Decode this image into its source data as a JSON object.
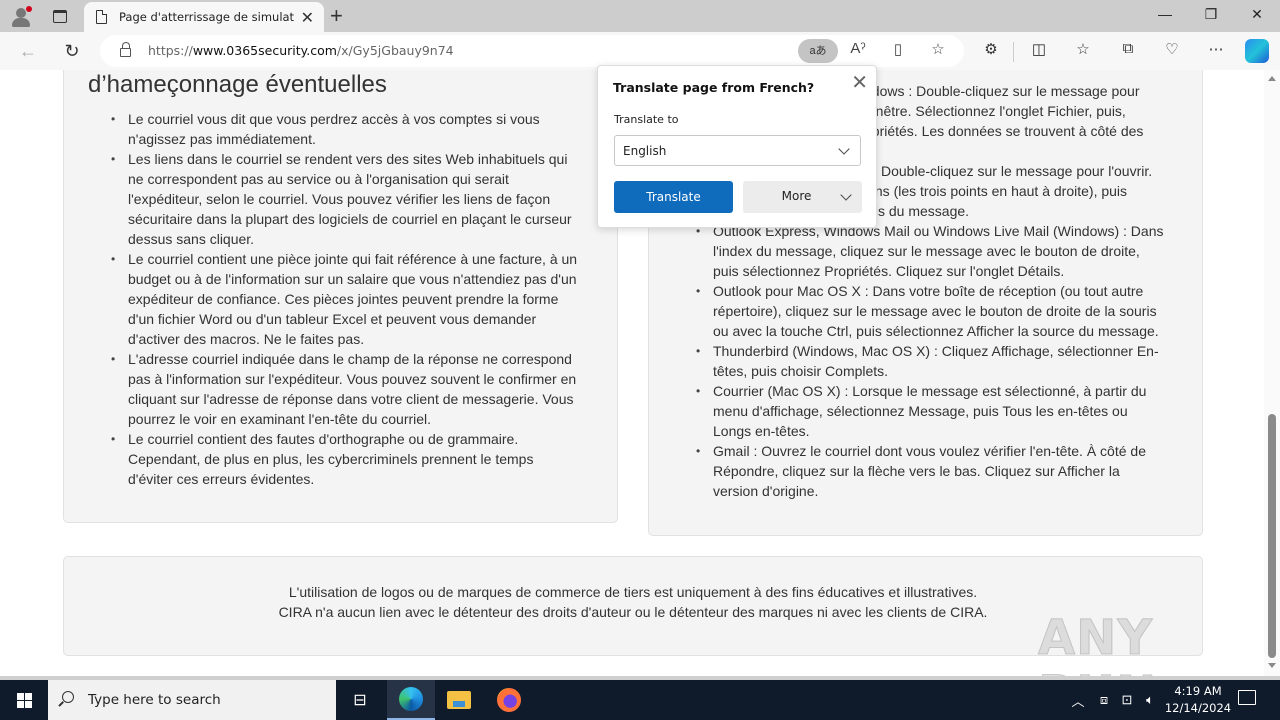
{
  "browser": {
    "tab_title": "Page d'atterrissage de simulation",
    "url_prefix": "https://",
    "url_host": "www.0365security.com",
    "url_path": "/x/Gy5jGbauy9n74",
    "translate_pill_label": "aあ",
    "icons": [
      "profile-icon",
      "tab-actions-icon",
      "document-icon",
      "close-tab-icon",
      "new-tab-icon",
      "minimize-icon",
      "restore-icon",
      "close-window-icon",
      "back-icon",
      "refresh-icon",
      "lock-icon",
      "translate-icon",
      "read-aloud-icon",
      "immersive-reader-icon",
      "favorite-star-icon",
      "extensions-icon",
      "split-screen-icon",
      "favorites-icon",
      "collections-icon",
      "browser-essentials-icon",
      "more-icon",
      "copilot-icon"
    ]
  },
  "translate_popup": {
    "title": "Translate page from French?",
    "label": "Translate to",
    "selected_language": "English",
    "translate_button": "Translate",
    "more_button": "More"
  },
  "left_panel": {
    "heading": "d’hameçonnage éventuelles",
    "items": [
      "Le courriel vous dit que vous perdrez accès à vos comptes si vous n'agissez pas immédiatement.",
      "Les liens dans le courriel se rendent vers des sites Web inhabituels qui ne correspondent pas au service ou à l'organisation qui serait l'expéditeur, selon le courriel. Vous pouvez vérifier les liens de façon sécuritaire dans la plupart des logiciels de courriel en plaçant le curseur dessus sans cliquer.",
      "Le courriel contient une pièce jointe qui fait référence à une facture, à un budget ou à de l'information sur un salaire que vous n'attendiez pas d'un expéditeur de confiance. Ces pièces jointes peuvent prendre la forme d'un fichier Word ou d'un tableur Excel et peuvent vous demander d'activer des macros. Ne le faites pas.",
      "L'adresse courriel indiquée dans le champ de la réponse ne correspond pas à l'information sur l'expéditeur. Vous pouvez souvent le confirmer en cliquant sur l'adresse de réponse dans votre client de messagerie. Vous pourrez le voir en examinant l'en-tête du courriel.",
      "Le courriel contient des fautes d'orthographe ou de grammaire. Cependant, de plus en plus, les cybercriminels prennent le temps d'éviter ces erreurs évidentes."
    ]
  },
  "right_panel": {
    "partial_lines": [
      "ndows : Double-cliquez sur le message pour",
      "fenêtre. Sélectionnez l'onglet Fichier, puis,",
      "opriétés. Les données se trouvent à côté des",
      "Double-cliquez sur le message pour l'ouvrir.",
      "ions (les trois points en haut à droite), puis",
      "ails du message."
    ],
    "items": [
      "Outlook Express, Windows Mail ou Windows Live Mail (Windows) : Dans l'index du message, cliquez sur le message avec le bouton de droite, puis sélectionnez Propriétés. Cliquez sur l'onglet Détails.",
      "Outlook pour Mac OS X : Dans votre boîte de réception (ou tout autre répertoire), cliquez sur le message avec le bouton de droite de la souris ou avec la touche Ctrl, puis sélectionnez Afficher la source du message.",
      "Thunderbird (Windows, Mac OS X) : Cliquez Affichage, sélectionner En-têtes, puis choisir Complets.",
      "Courrier (Mac OS X) : Lorsque le message est sélectionné, à partir du menu d'affichage, sélectionnez Message, puis Tous les en-têtes ou Longs en-têtes.",
      "Gmail : Ouvrez le courriel dont vous voulez vérifier l'en-tête. À côté de Répondre, cliquez sur la flèche vers le bas. Cliquez sur Afficher la version d'origine."
    ]
  },
  "footer": {
    "line1": "L'utilisation de logos ou de marques de commerce de tiers est uniquement à des fins éducatives et illustratives.",
    "line2": "CIRA n'a aucun lien avec le détenteur des droits d'auteur ou le détenteur des marques ni avec les clients de CIRA."
  },
  "watermark": "ANY RUN",
  "taskbar": {
    "search_placeholder": "Type here to search",
    "time": "4:19 AM",
    "date": "12/14/2024"
  }
}
